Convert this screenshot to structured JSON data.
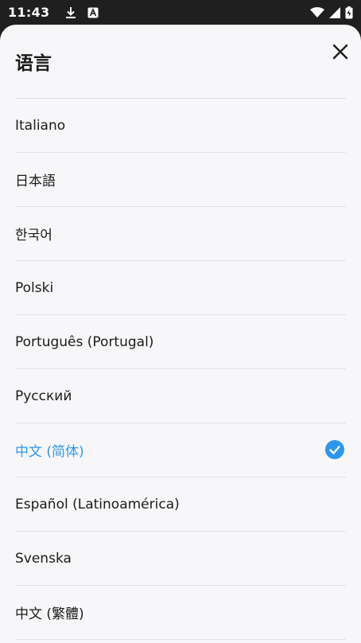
{
  "status_bar": {
    "time": "11:43",
    "icons": [
      "download-icon",
      "font-a-icon",
      "wifi-icon",
      "signal-icon",
      "battery-charging-icon"
    ]
  },
  "sheet": {
    "title": "语言",
    "close_icon": "close-icon"
  },
  "languages": [
    {
      "label": "Italiano",
      "selected": false
    },
    {
      "label": "日本語",
      "selected": false
    },
    {
      "label": "한국어",
      "selected": false
    },
    {
      "label": "Polski",
      "selected": false
    },
    {
      "label": "Português (Portugal)",
      "selected": false
    },
    {
      "label": "Русский",
      "selected": false
    },
    {
      "label": "中文 (简体)",
      "selected": true
    },
    {
      "label": "Español (Latinoamérica)",
      "selected": false
    },
    {
      "label": "Svenska",
      "selected": false
    },
    {
      "label": "中文 (繁體)",
      "selected": false
    }
  ],
  "colors": {
    "accent": "#2f97eb",
    "sheet_bg": "#f7f7f9",
    "status_bg": "#1f1f1f"
  }
}
